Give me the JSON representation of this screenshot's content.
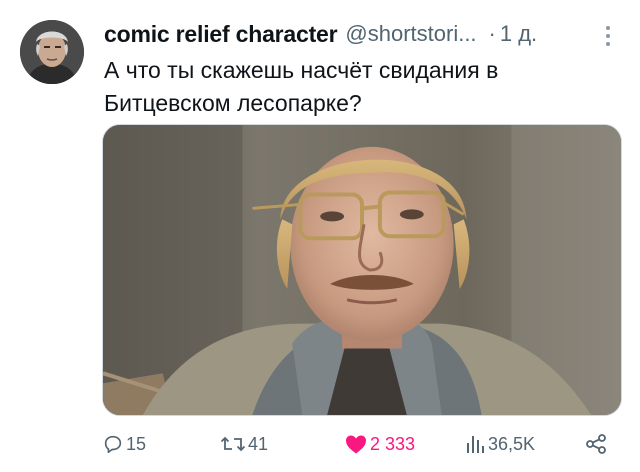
{
  "tweet": {
    "display_name": "comic relief character",
    "handle": "@shortstori...",
    "separator": "·",
    "time": "1 д.",
    "text_line1": "А что ты скажешь насчёт свидания в",
    "text_line2": "Битцевском лесопарке?",
    "avatar_icon": "user-avatar",
    "media_icon": "photo-man-glasses-mustache"
  },
  "actions": {
    "replies": "15",
    "retweets": "41",
    "likes": "2 333",
    "views": "36,5K",
    "like_color": "#f91880",
    "icon_color": "#536471",
    "reply_icon": "reply-icon",
    "retweet_icon": "retweet-icon",
    "like_icon": "heart-icon",
    "views_icon": "views-icon",
    "share_icon": "share-icon"
  }
}
